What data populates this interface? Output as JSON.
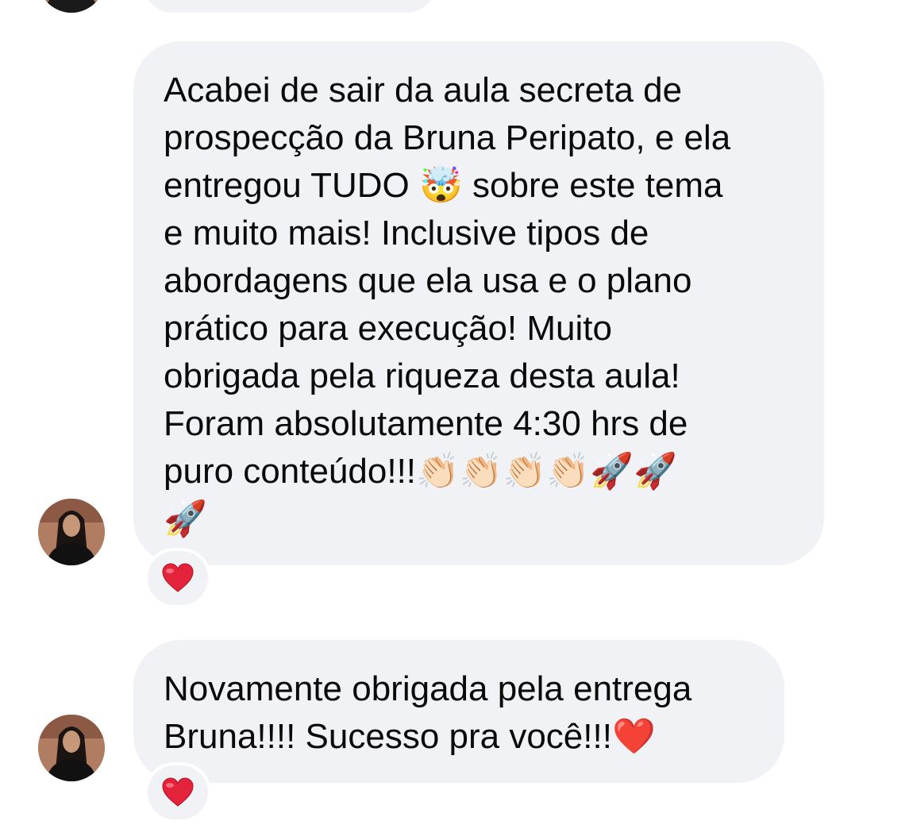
{
  "conversation": {
    "messages": [
      {
        "text": "Acabei de sair da aula secreta de\nprospecção da Bruna Peripato, e ela\nentregou TUDO 🤯 sobre este tema\ne muito mais! Inclusive tipos de\nabordagens que ela usa e o plano\nprático para execução! Muito\nobrigada pela riqueza desta aula!\nForam absolutamente 4:30 hrs de\npuro conteúdo!!!👏🏻👏🏻👏🏻👏🏻🚀🚀\n🚀",
        "reaction": "❤️"
      },
      {
        "text": "Novamente obrigada pela entrega\nBruna!!!! Sucesso pra você!!!❤️",
        "reaction": "❤️"
      }
    ]
  },
  "colors": {
    "bubble": "#f1f2f6",
    "heart": "#e0245e",
    "text": "#0a0a0a"
  },
  "icons": {
    "avatar": "profile-photo",
    "reaction": "red-heart-icon"
  }
}
